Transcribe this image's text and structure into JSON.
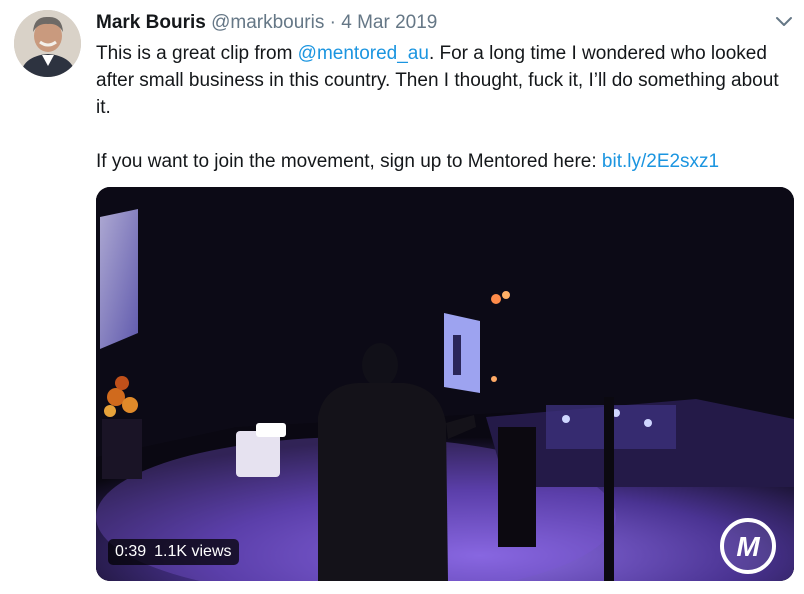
{
  "tweet": {
    "author_name": "Mark Bouris",
    "handle": "@markbouris",
    "separator": "·",
    "date": "4 Mar 2019",
    "text_part1": "This is a great clip from ",
    "mention": "@mentored_au",
    "text_part2": ". For a long time I wondered who looked after small business in this country. Then I thought, fuck it, I’ll do something about it.",
    "text_line2": "If you want to join the movement, sign up to Mentored here: ",
    "link": "bit.ly/2E2sxz1"
  },
  "media": {
    "duration": "0:39",
    "views": "1.1K views",
    "logo_letter": "M"
  },
  "icons": {
    "menu": "chevron-down-icon",
    "avatar": "avatar"
  },
  "colors": {
    "link": "#1b95e0",
    "secondary_text": "#657786",
    "stage_purple": "#7a55d8"
  }
}
